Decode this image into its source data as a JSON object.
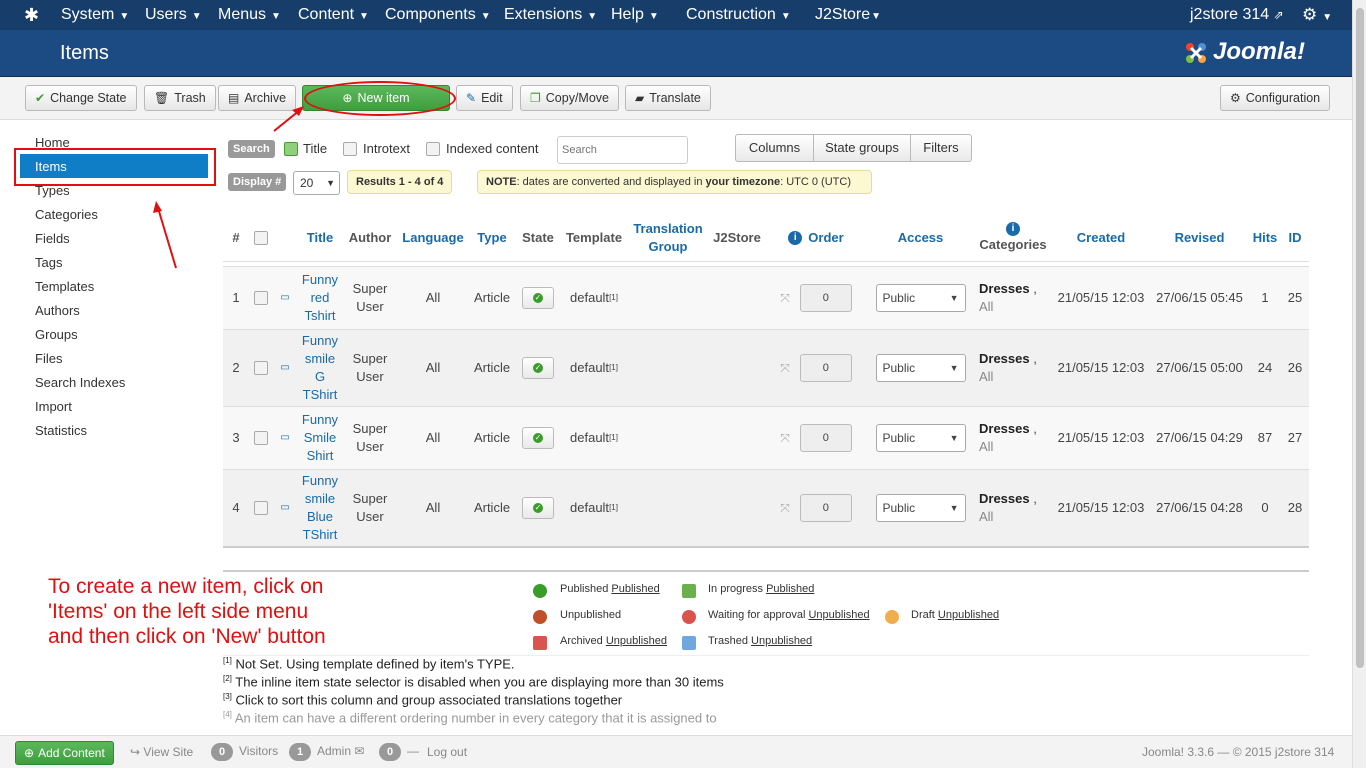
{
  "topnav": {
    "brand_icon": "joomla-icon",
    "menus": [
      "System",
      "Users",
      "Menus",
      "Content",
      "Components",
      "Extensions",
      "Help",
      "Construction",
      "J2Store"
    ],
    "site_name": "j2store 314",
    "settings_icon": "gear-icon"
  },
  "header": {
    "title": "Items",
    "logo": "Joomla!"
  },
  "toolbar": {
    "change_state": "Change State",
    "trash": "Trash",
    "archive": "Archive",
    "new_item": "New item",
    "edit": "Edit",
    "copy_move": "Copy/Move",
    "translate": "Translate",
    "configuration": "Configuration"
  },
  "sidebar": {
    "items": [
      "Home",
      "Items",
      "Types",
      "Categories",
      "Fields",
      "Tags",
      "Templates",
      "Authors",
      "Groups",
      "Files",
      "Search Indexes",
      "Import",
      "Statistics"
    ],
    "active": "Items"
  },
  "filters": {
    "search_label": "Search",
    "opt_title": "Title",
    "opt_introtext": "Introtext",
    "opt_indexed": "Indexed content",
    "search_placeholder": "Search",
    "columns": "Columns",
    "state_groups": "State groups",
    "filters": "Filters",
    "display_label": "Display #",
    "display_value": "20",
    "results": "Results 1 - 4 of 4",
    "note_prefix": "NOTE",
    "note_text": ": dates are converted and displayed in ",
    "note_bold": "your timezone",
    "note_tz": ": UTC 0 (UTC)"
  },
  "table": {
    "headers": {
      "num": "#",
      "title": "Title",
      "author": "Author",
      "language": "Language",
      "type": "Type",
      "state": "State",
      "template": "Template",
      "translation_group": "Translation Group",
      "j2store": "J2Store",
      "order": "Order",
      "access": "Access",
      "categories": "Categories",
      "created": "Created",
      "revised": "Revised",
      "hits": "Hits",
      "id": "ID"
    },
    "rows": [
      {
        "num": "1",
        "title": "Funny red Tshirt",
        "author": "Super User",
        "language": "All",
        "type": "Article",
        "template": "default",
        "order": "0",
        "access": "Public",
        "category": "Dresses",
        "category_sub": "All",
        "created": "21/05/15 12:03",
        "revised": "27/06/15 05:45",
        "hits": "1",
        "id": "25"
      },
      {
        "num": "2",
        "title": "Funny smile G TShirt",
        "author": "Super User",
        "language": "All",
        "type": "Article",
        "template": "default",
        "order": "0",
        "access": "Public",
        "category": "Dresses",
        "category_sub": "All",
        "created": "21/05/15 12:03",
        "revised": "27/06/15 05:00",
        "hits": "24",
        "id": "26"
      },
      {
        "num": "3",
        "title": "Funny Smile Shirt",
        "author": "Super User",
        "language": "All",
        "type": "Article",
        "template": "default",
        "order": "0",
        "access": "Public",
        "category": "Dresses",
        "category_sub": "All",
        "created": "21/05/15 12:03",
        "revised": "27/06/15 04:29",
        "hits": "87",
        "id": "27"
      },
      {
        "num": "4",
        "title": "Funny smile Blue TShirt",
        "author": "Super User",
        "language": "All",
        "type": "Article",
        "template": "default",
        "order": "0",
        "access": "Public",
        "category": "Dresses",
        "category_sub": "All",
        "created": "21/05/15 12:03",
        "revised": "27/06/15 04:28",
        "hits": "0",
        "id": "28"
      }
    ]
  },
  "annotation": "To create a new item, click on\n'Items' on the left side menu\nand then click on 'New' button",
  "legend": {
    "published": "Published",
    "published_link": "Published",
    "unpublished": "Unpublished",
    "archived": "Archived",
    "archived_link": "Unpublished",
    "in_progress": "In progress",
    "in_progress_link": "Published",
    "waiting": "Waiting for approval",
    "waiting_link": "Unpublished",
    "trashed": "Trashed",
    "trashed_link": "Unpublished",
    "draft": "Draft",
    "draft_link": "Unpublished"
  },
  "footnotes": [
    {
      "n": "[1]",
      "text": "Not Set. Using template defined by item's TYPE."
    },
    {
      "n": "[2]",
      "text": "The inline item state selector is disabled when you are displaying more than 30 items"
    },
    {
      "n": "[3]",
      "text": "Click to sort this column and group associated translations together"
    },
    {
      "n": "[4]",
      "text": "An item can have a different ordering number in every category that it is assigned to"
    }
  ],
  "statusbar": {
    "add_content": "Add Content",
    "view_site": "View Site",
    "visitors_count": "0",
    "visitors": "Visitors",
    "admin_count": "1",
    "admin": "Admin",
    "messages_count": "0",
    "logout": "Log out",
    "version": "Joomla! 3.3.6 — © 2015 j2store 314"
  },
  "colors": {
    "nav": "#173d6b",
    "header": "#1c4a83",
    "active": "#0f7ec7",
    "annotation": "#e01010",
    "green": "#4cae4c"
  }
}
